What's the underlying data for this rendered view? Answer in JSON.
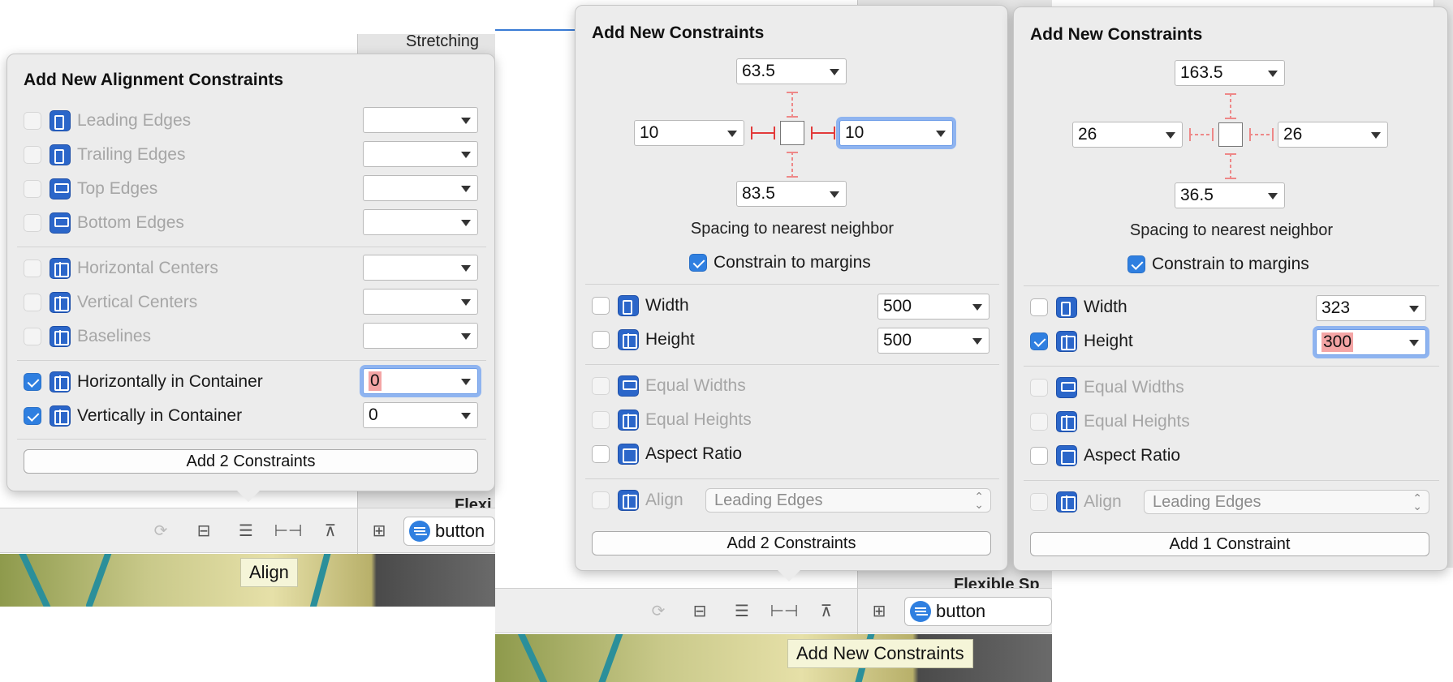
{
  "left": {
    "stretching_label": "Stretching",
    "panel_title": "Add New Alignment Constraints",
    "rows": [
      {
        "label": "Leading Edges",
        "value": ""
      },
      {
        "label": "Trailing Edges",
        "value": ""
      },
      {
        "label": "Top Edges",
        "value": ""
      },
      {
        "label": "Bottom Edges",
        "value": ""
      },
      {
        "label": "Horizontal Centers",
        "value": ""
      },
      {
        "label": "Vertical Centers",
        "value": ""
      },
      {
        "label": "Baselines",
        "value": ""
      },
      {
        "label": "Horizontally in Container",
        "value": "0",
        "checked": true
      },
      {
        "label": "Vertically in Container",
        "value": "0",
        "checked": true
      }
    ],
    "add_button": "Add 2 Constraints",
    "search_text": "button",
    "tooltip": "Align",
    "partial_text": "Flexi"
  },
  "middle": {
    "panel_title": "Add New Constraints",
    "top": "63.5",
    "left": "10",
    "right": "10",
    "bottom": "83.5",
    "spacing_label": "Spacing to nearest neighbor",
    "margins_label": "Constrain to margins",
    "width_label": "Width",
    "width_value": "500",
    "height_label": "Height",
    "height_value": "500",
    "equal_widths": "Equal Widths",
    "equal_heights": "Equal Heights",
    "aspect_ratio": "Aspect Ratio",
    "align_label": "Align",
    "align_value": "Leading Edges",
    "add_button": "Add 2 Constraints",
    "search_text": "button",
    "tooltip": "Add New Constraints",
    "partial_text": "Flexible Sp"
  },
  "right": {
    "panel_title": "Add New Constraints",
    "top": "163.5",
    "left": "26",
    "right": "26",
    "bottom": "36.5",
    "spacing_label": "Spacing to nearest neighbor",
    "margins_label": "Constrain to margins",
    "width_label": "Width",
    "width_value": "323",
    "height_label": "Height",
    "height_value": "300",
    "equal_widths": "Equal Widths",
    "equal_heights": "Equal Heights",
    "aspect_ratio": "Aspect Ratio",
    "align_label": "Align",
    "align_value": "Leading Edges",
    "add_button": "Add 1 Constraint"
  },
  "colors": {
    "accent": "#2f7fe0",
    "icon_blue": "#2b66c9",
    "focus_ring": "#8fb4f0",
    "error_highlight": "#f4a5a5",
    "strut_red": "#e23a3a"
  }
}
